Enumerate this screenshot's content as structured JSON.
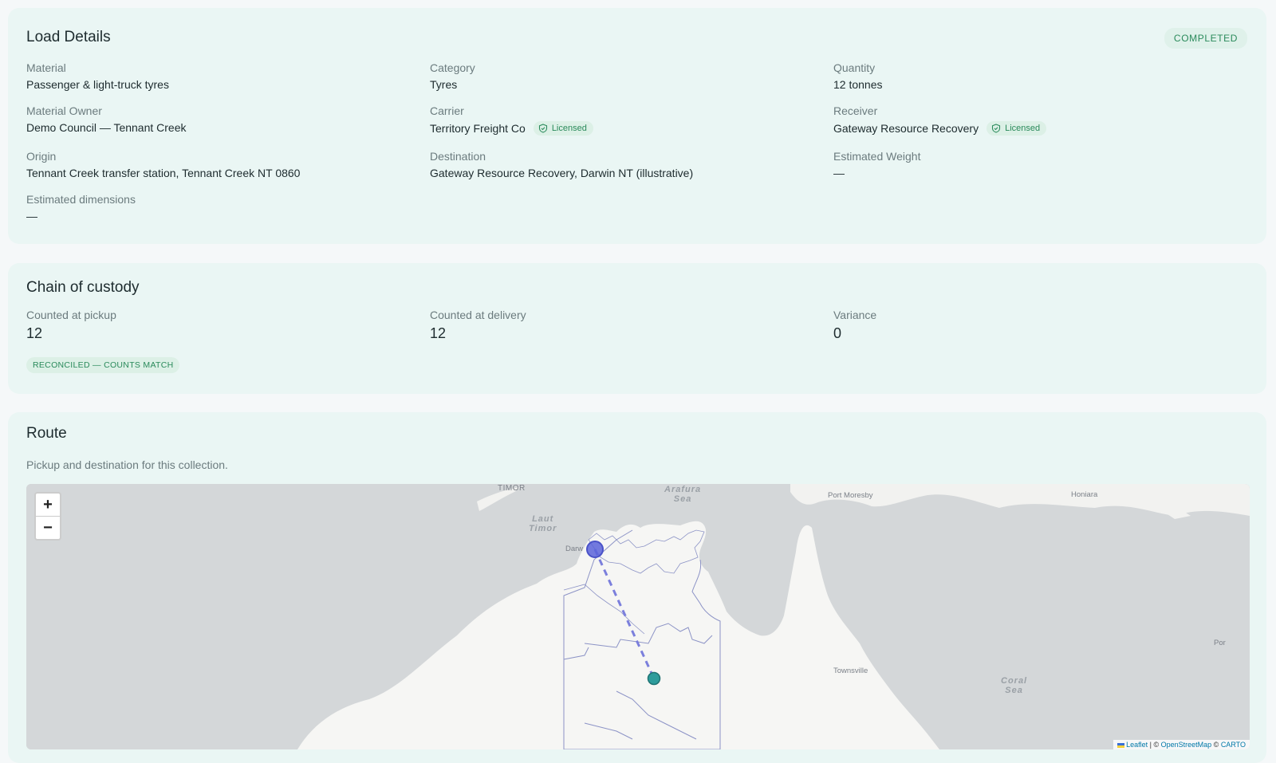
{
  "load_details": {
    "title": "Load Details",
    "status": "COMPLETED",
    "fields": {
      "material": {
        "label": "Material",
        "value": "Passenger & light-truck tyres"
      },
      "category": {
        "label": "Category",
        "value": "Tyres"
      },
      "quantity": {
        "label": "Quantity",
        "value": "12 tonnes"
      },
      "material_owner": {
        "label": "Material Owner",
        "value": "Demo Council — Tennant Creek"
      },
      "carrier": {
        "label": "Carrier",
        "value": "Territory Freight Co",
        "badge": "Licensed"
      },
      "receiver": {
        "label": "Receiver",
        "value": "Gateway Resource Recovery",
        "badge": "Licensed"
      },
      "origin": {
        "label": "Origin",
        "value": "Tennant Creek transfer station, Tennant Creek NT 0860"
      },
      "destination": {
        "label": "Destination",
        "value": "Gateway Resource Recovery, Darwin NT (illustrative)"
      },
      "estimated_weight": {
        "label": "Estimated Weight",
        "value": "—"
      },
      "estimated_dimensions": {
        "label": "Estimated dimensions",
        "value": "—"
      }
    },
    "colors": {
      "licensed_bg": "#dcf0e6",
      "licensed_fg": "#2a8a5b"
    }
  },
  "custody": {
    "title": "Chain of custody",
    "pickup": {
      "label": "Counted at pickup",
      "value": "12"
    },
    "delivery": {
      "label": "Counted at delivery",
      "value": "12"
    },
    "variance": {
      "label": "Variance",
      "value": "0"
    },
    "status": "RECONCILED — COUNTS MATCH"
  },
  "route": {
    "title": "Route",
    "subtitle": "Pickup and destination for this collection.",
    "map": {
      "zoom_in": "+",
      "zoom_out": "−",
      "place_labels": {
        "timor": "TIMOR",
        "laut_timor": "Laut\nTimor",
        "arafura": "Arafura\nSea",
        "port_moresby": "Port Moresby",
        "honiara": "Honiara",
        "darwin": "Darw",
        "townsville": "Townsville",
        "coral_sea": "Coral\nSea",
        "port_edge": "Por"
      },
      "attribution": {
        "leaflet": "Leaflet",
        "osm": "OpenStreetMap",
        "carto": "CARTO",
        "sep1": " | © ",
        "sep2": " © "
      },
      "marker_colors": {
        "destination": "#5b63d9",
        "origin": "#2d9c9c",
        "route": "#7b7fdc"
      }
    }
  }
}
